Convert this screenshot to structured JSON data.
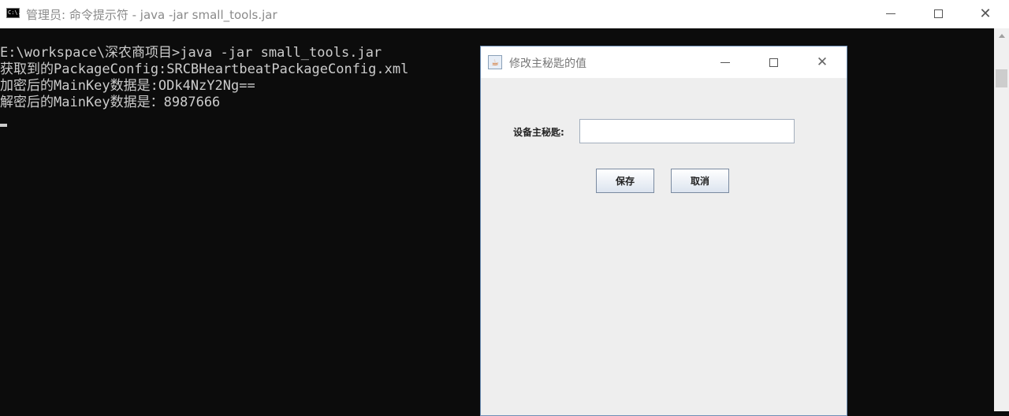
{
  "cmd_window": {
    "icon_text": "C:\\.",
    "title": "管理员: 命令提示符 - java  -jar small_tools.jar",
    "console_lines": [
      "E:\\workspace\\深农商项目>java -jar small_tools.jar",
      "获取到的PackageConfig:SRCBHeartbeatPackageConfig.xml",
      "加密后的MainKey数据是:ODk4NzY2Ng==",
      "解密后的MainKey数据是：8987666"
    ]
  },
  "dialog": {
    "title": "修改主秘匙的值",
    "field_label": "设备主秘匙:",
    "field_value": "",
    "save_label": "保存",
    "cancel_label": "取消"
  },
  "icons": {
    "cmd": "terminal-icon",
    "java": "java-cup-icon",
    "minimize": "minimize-icon",
    "maximize": "maximize-icon",
    "close": "close-icon",
    "scroll_up": "scroll-up-arrow-icon"
  }
}
